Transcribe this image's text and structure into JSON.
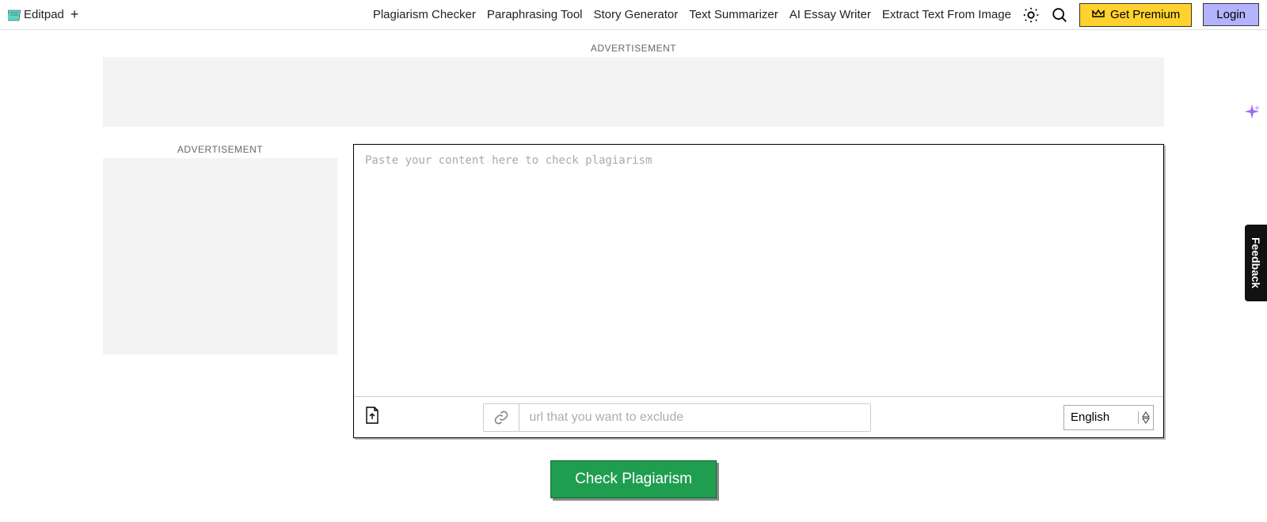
{
  "header": {
    "brand": "Editpad",
    "nav_links": [
      "Plagiarism Checker",
      "Paraphrasing Tool",
      "Story Generator",
      "Text Summarizer",
      "AI Essay Writer",
      "Extract Text From Image"
    ],
    "premium_label": "Get Premium",
    "login_label": "Login"
  },
  "ads": {
    "label": "ADVERTISEMENT"
  },
  "editor": {
    "placeholder": "Paste your content here to check plagiarism",
    "url_placeholder": "url that you want to exclude",
    "language": "English"
  },
  "actions": {
    "check_label": "Check Plagiarism"
  },
  "widgets": {
    "feedback_label": "Feedback"
  }
}
